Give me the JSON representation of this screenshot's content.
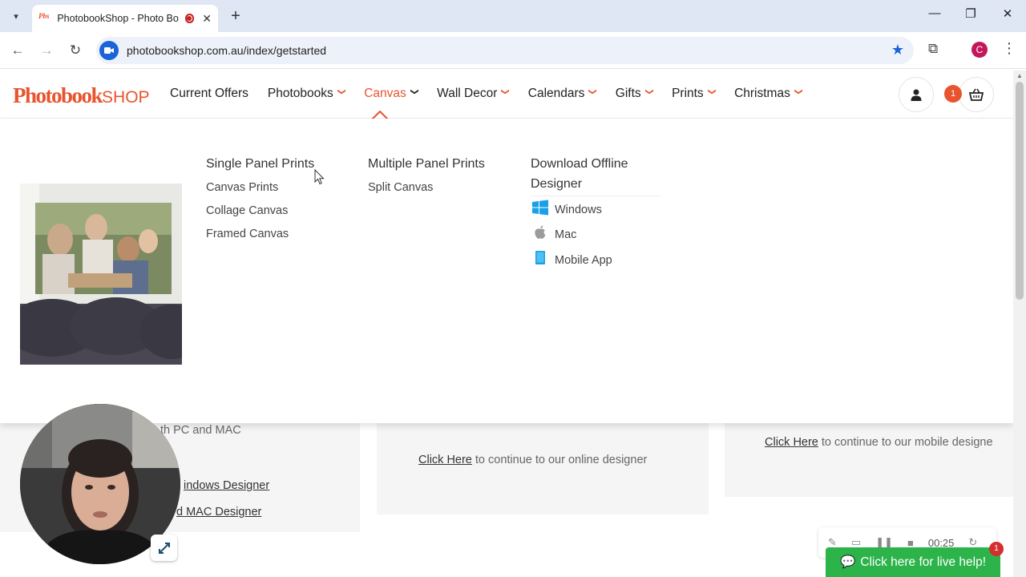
{
  "browser": {
    "tab_title": "PhotobookShop - Photo Bo",
    "url": "photobookshop.com.au/index/getstarted",
    "profile_initial": "C"
  },
  "site": {
    "logo_bold": "Photobook",
    "logo_thin": "SHOP",
    "nav": [
      {
        "label": "Current Offers"
      },
      {
        "label": "Photobooks"
      },
      {
        "label": "Canvas"
      },
      {
        "label": "Wall Decor"
      },
      {
        "label": "Calendars"
      },
      {
        "label": "Gifts"
      },
      {
        "label": "Prints"
      },
      {
        "label": "Christmas"
      }
    ],
    "cart_count": "1",
    "accent_color": "#e8542e"
  },
  "megamenu": {
    "single_panel": {
      "heading": "Single Panel Prints",
      "links": [
        "Canvas Prints",
        "Collage Canvas",
        "Framed Canvas"
      ]
    },
    "multiple_panel": {
      "heading": "Multiple Panel Prints",
      "links": [
        "Split Canvas"
      ]
    },
    "download": {
      "heading_line1": "Download Offline",
      "heading_line2": "Designer",
      "links": [
        "Windows",
        "Mac",
        "Mobile App"
      ]
    }
  },
  "page": {
    "left_card_text": "th PC and MAC",
    "left_link1": "indows Designer",
    "left_link2": "d MAC Designer",
    "middle_link": "Click Here",
    "middle_text": " to continue to our online designer",
    "right_link": "Click Here",
    "right_text": " to continue to our mobile designe"
  },
  "recorder": {
    "time": "00:25"
  },
  "chat": {
    "label": "Click here for live help!",
    "badge": "1"
  }
}
